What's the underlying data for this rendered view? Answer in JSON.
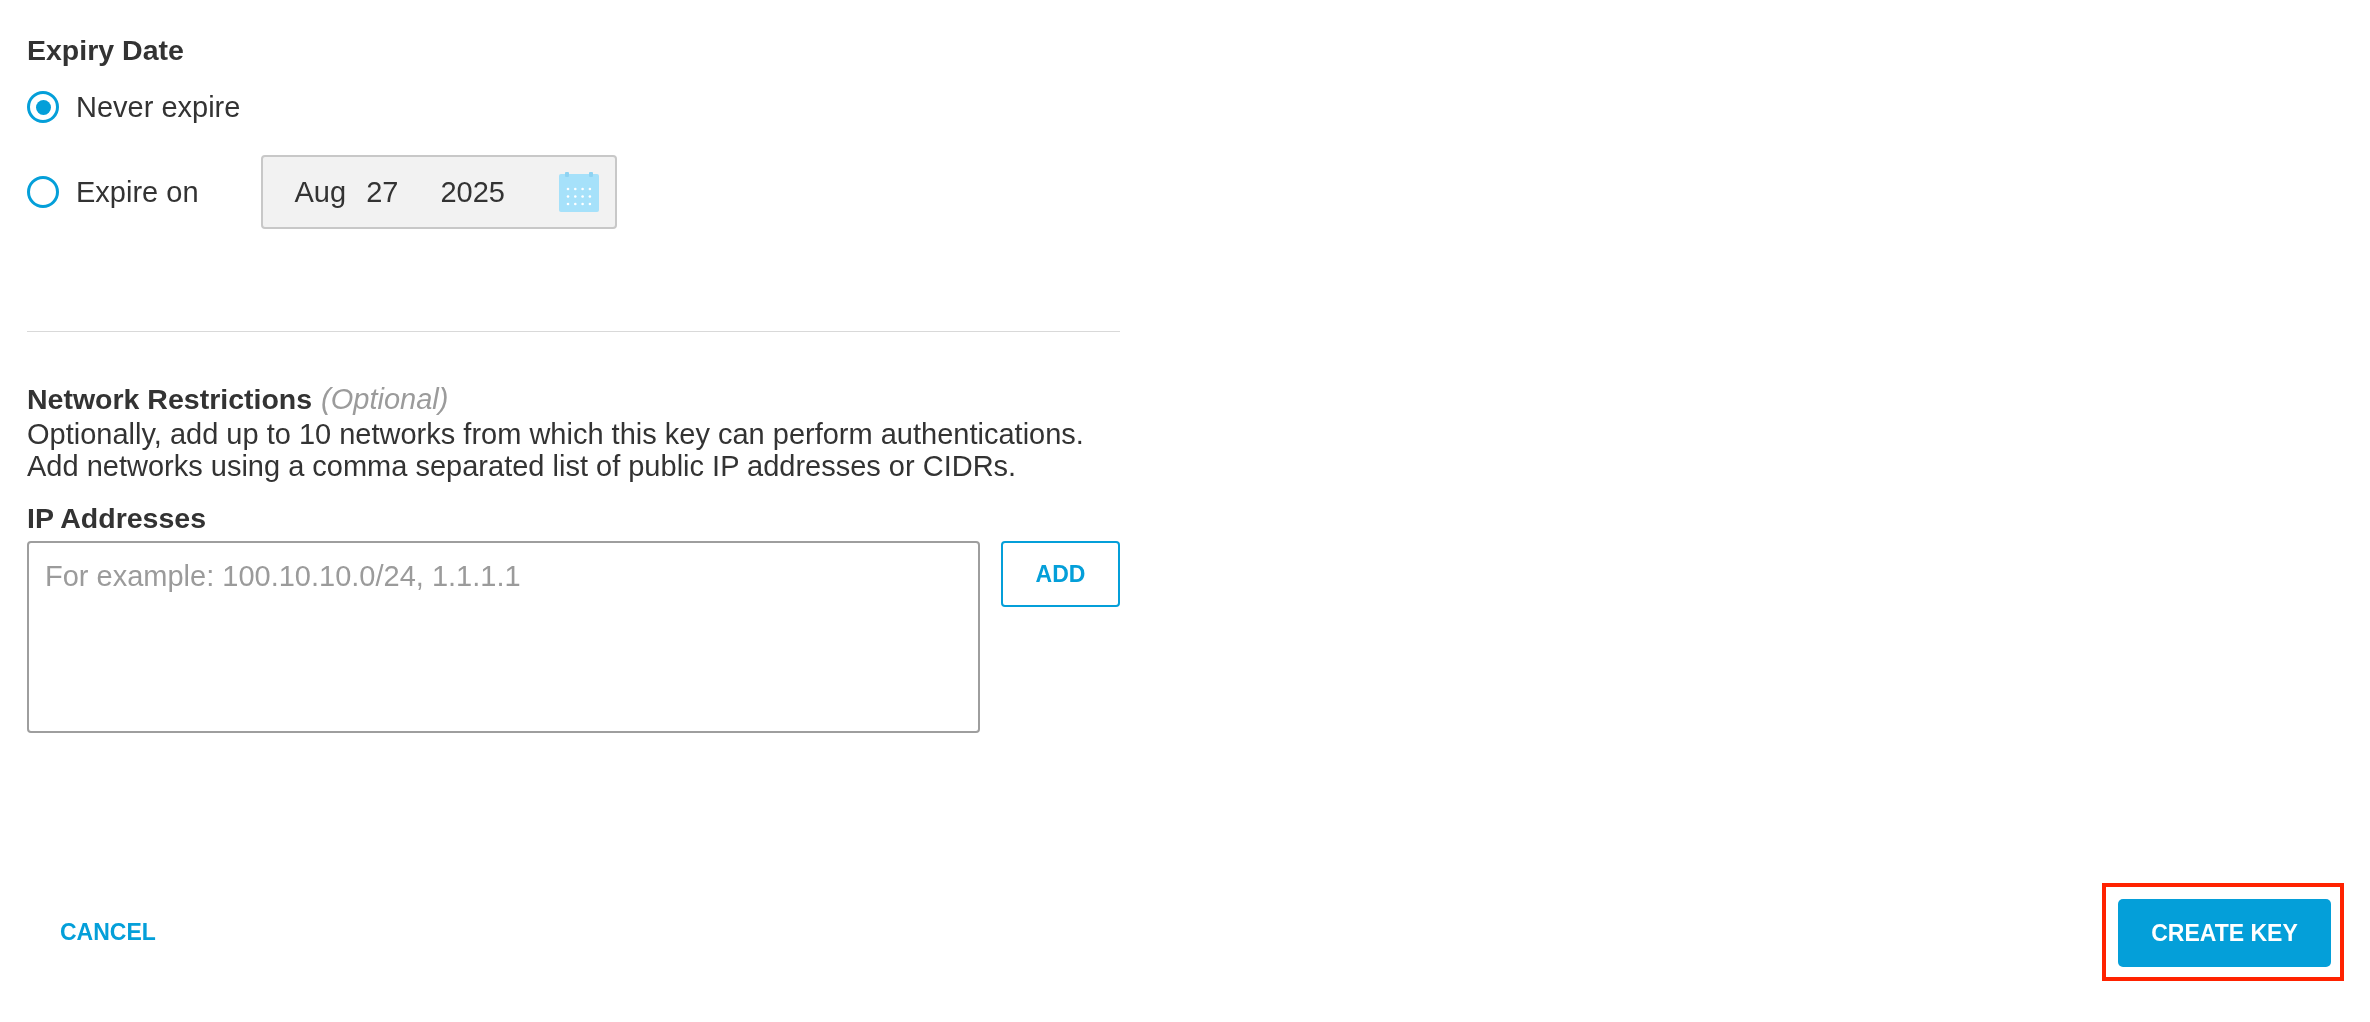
{
  "expiry": {
    "title": "Expiry Date",
    "options": [
      {
        "label": "Never expire",
        "selected": true
      },
      {
        "label": "Expire on",
        "selected": false,
        "date": {
          "month": "Aug",
          "day": "27",
          "year": "2025"
        }
      }
    ]
  },
  "network": {
    "title": "Network Restrictions",
    "note": "(Optional)",
    "description": "Optionally, add up to 10 networks from which this key can perform authentications.\nAdd networks using a comma separated list of public IP addresses or CIDRs.",
    "ip_label": "IP Addresses",
    "ip_field": {
      "placeholder": "For example: 100.10.10.0/24, 1.1.1.1"
    },
    "add_button": "ADD"
  },
  "footer": {
    "cancel_button": "CANCEL",
    "create_button": {
      "label": "CREATE KEY",
      "highlighted": true
    }
  }
}
